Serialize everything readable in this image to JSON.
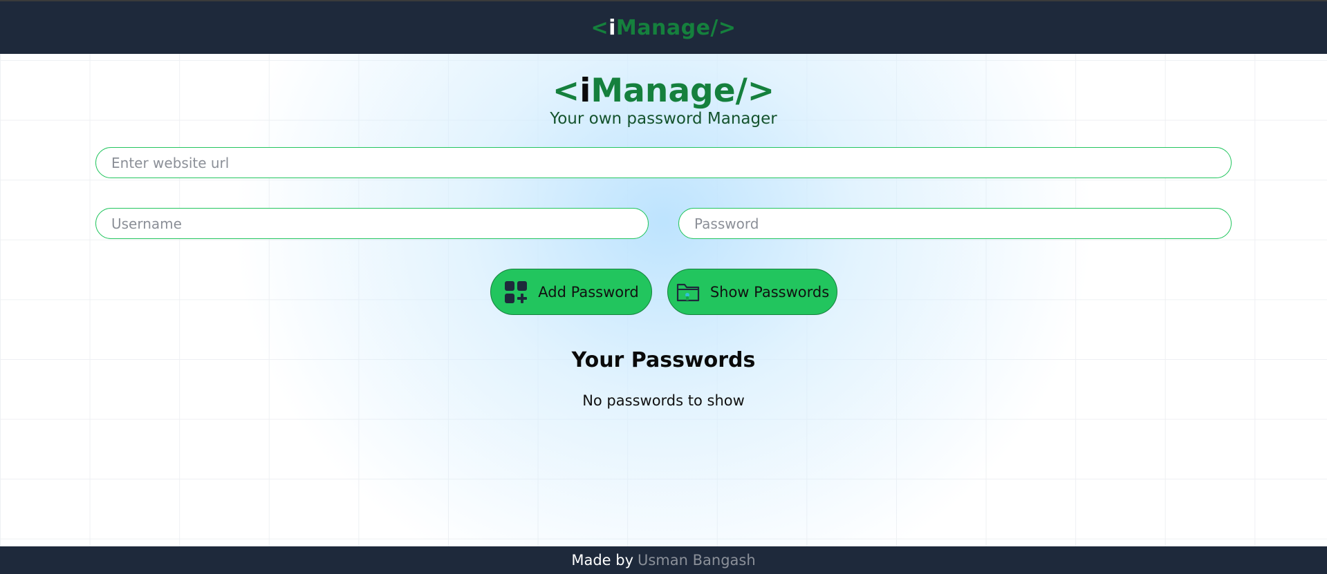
{
  "nav": {
    "logo_left": "<",
    "logo_mid": "i",
    "logo_right": "Manage/>"
  },
  "header": {
    "title_left": "<",
    "title_mid": "i",
    "title_right": "Manage/>",
    "subtitle": "Your own password Manager"
  },
  "form": {
    "website_placeholder": "Enter website url",
    "website_value": "",
    "username_placeholder": "Username",
    "username_value": "",
    "password_placeholder": "Password",
    "password_value": ""
  },
  "buttons": {
    "add_label": "Add Password",
    "add_icon": "grid-plus-icon",
    "show_label": "Show Passwords",
    "show_icon": "folder-icon"
  },
  "passwords": {
    "heading": "Your Passwords",
    "empty_message": "No passwords to show"
  },
  "footer": {
    "made_by": "Made by",
    "author": "Usman Bangash"
  },
  "colors": {
    "brand_green": "#15803d",
    "button_green": "#22c55e",
    "nav_bg": "#1e293b"
  }
}
